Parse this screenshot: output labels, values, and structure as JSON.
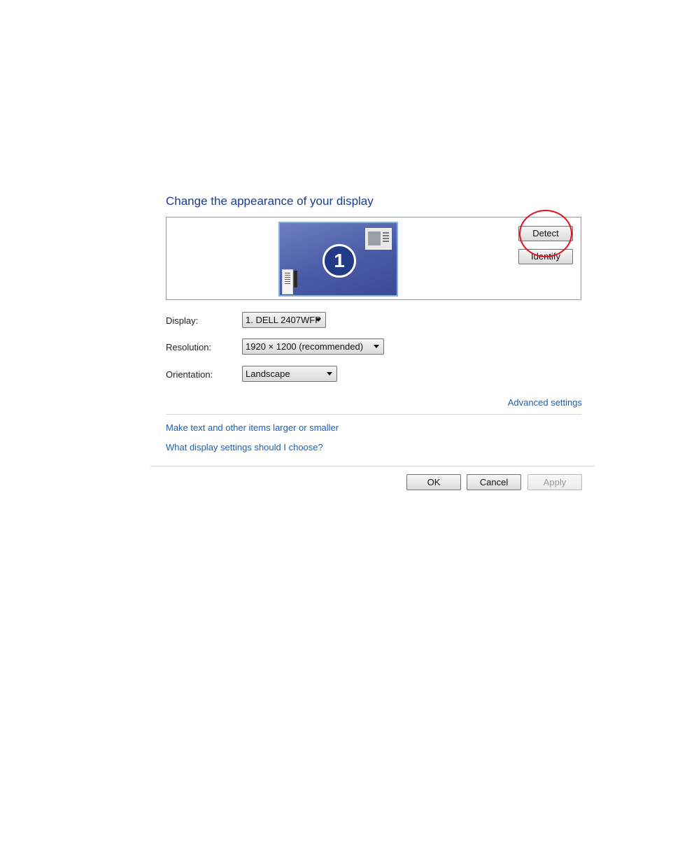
{
  "page": {
    "title": "Change the appearance of your display"
  },
  "preview": {
    "monitor_number": "1"
  },
  "buttons": {
    "detect": "Detect",
    "identify": "Identify",
    "ok": "OK",
    "cancel": "Cancel",
    "apply": "Apply"
  },
  "form": {
    "display": {
      "label": "Display:",
      "value": "1. DELL 2407WFP"
    },
    "resolution": {
      "label": "Resolution:",
      "value": "1920 × 1200 (recommended)"
    },
    "orientation": {
      "label": "Orientation:",
      "value": "Landscape"
    }
  },
  "links": {
    "advanced": "Advanced settings",
    "larger_smaller": "Make text and other items larger or smaller",
    "which_settings": "What display settings should I choose?"
  },
  "colors": {
    "title": "#1e3c8c",
    "link": "#1a5fb4",
    "annotation_circle": "#e0101e",
    "monitor": "#4a5ba6"
  },
  "icons": [
    "monitor-thumbnail-icon",
    "window-thumbnail-icon",
    "sidebar-thumbnail-icon",
    "dropdown-arrow-icon"
  ]
}
